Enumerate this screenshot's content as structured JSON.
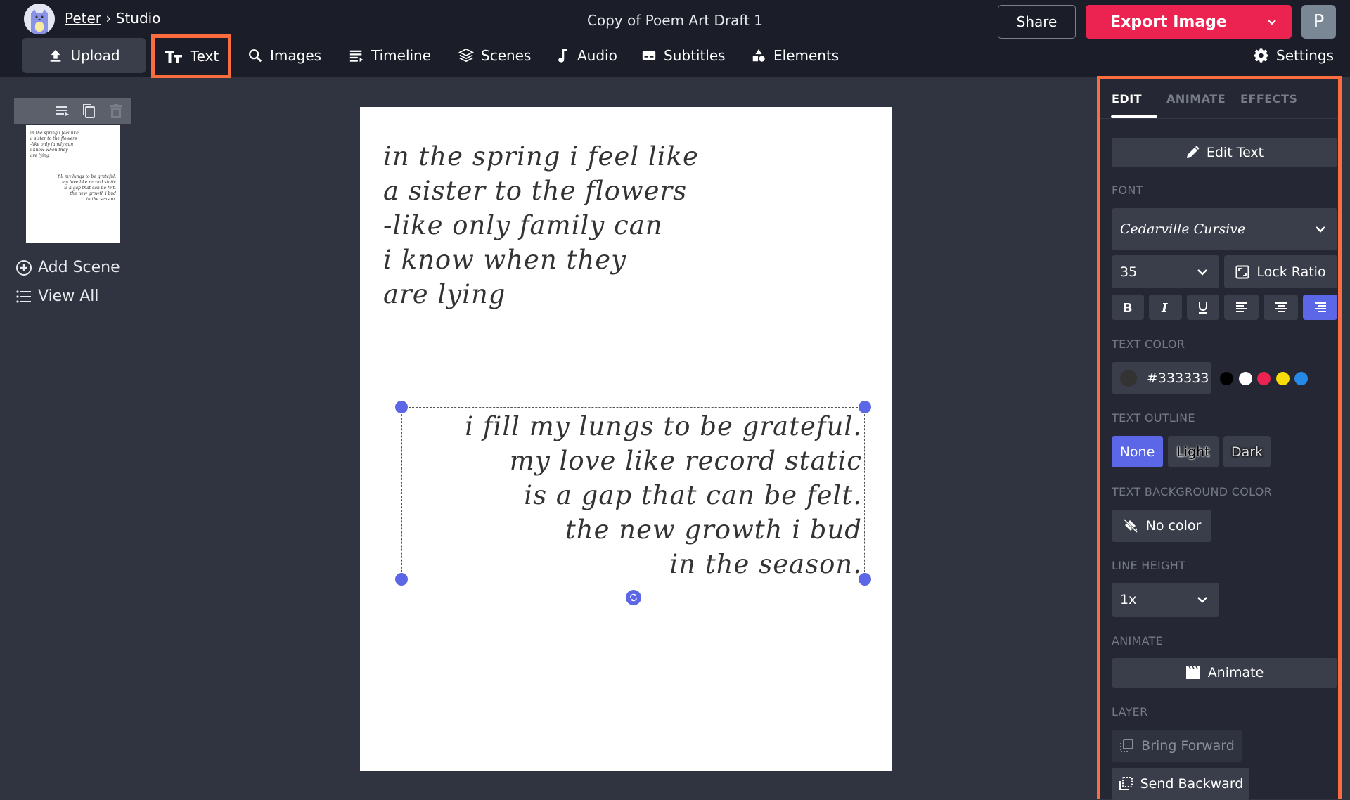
{
  "header": {
    "breadcrumb_user": "Peter",
    "breadcrumb_sep": "›",
    "breadcrumb_page": "Studio",
    "title": "Copy of Poem Art Draft 1",
    "share_label": "Share",
    "export_label": "Export Image",
    "user_initial": "P"
  },
  "nav": {
    "items": [
      {
        "label": "Upload",
        "icon": "upload-icon"
      },
      {
        "label": "Text",
        "icon": "text-icon"
      },
      {
        "label": "Images",
        "icon": "search-icon"
      },
      {
        "label": "Timeline",
        "icon": "timeline-icon"
      },
      {
        "label": "Scenes",
        "icon": "layers-icon"
      },
      {
        "label": "Audio",
        "icon": "music-note-icon"
      },
      {
        "label": "Subtitles",
        "icon": "subtitles-icon"
      },
      {
        "label": "Elements",
        "icon": "shapes-icon"
      }
    ],
    "settings_label": "Settings"
  },
  "sidebar": {
    "add_scene_label": "Add Scene",
    "view_all_label": "View All",
    "thumb_text_1": "in the spring i feel like\na sister to the flowers\n-like only family can\ni know when they\nare lying",
    "thumb_text_2": "i fill my lungs to be grateful.\nmy love like record static\nis a gap that can be felt.\nthe new growth i bud\nin the season."
  },
  "canvas": {
    "poem_top": "in the spring i feel like\na sister to the flowers\n-like only family can\ni know when they\nare lying",
    "poem_bottom": "i fill my lungs to be grateful.\nmy love like record static\nis a gap that can be felt.\nthe new growth i bud\nin the season."
  },
  "panel": {
    "tabs": [
      "EDIT",
      "ANIMATE",
      "EFFECTS"
    ],
    "active_tab": "EDIT",
    "edit_text_label": "Edit Text",
    "font_label": "FONT",
    "font_value": "Cedarville Cursive",
    "font_size": "35",
    "lock_ratio_label": "Lock Ratio",
    "format_buttons": [
      "bold",
      "italic",
      "underline",
      "align-left",
      "align-center",
      "align-right"
    ],
    "active_alignment": "align-right",
    "text_color_label": "TEXT COLOR",
    "text_color_value": "#333333",
    "swatches": [
      "#000000",
      "#ffffff",
      "#ec2350",
      "#f7dc0b",
      "#2589e8"
    ],
    "text_outline_label": "TEXT OUTLINE",
    "outline_options": [
      "None",
      "Light",
      "Dark"
    ],
    "outline_active": "None",
    "text_bg_label": "TEXT BACKGROUND COLOR",
    "no_color_label": "No color",
    "line_height_label": "LINE HEIGHT",
    "line_height_value": "1x",
    "animate_label": "ANIMATE",
    "animate_button": "Animate",
    "layer_label": "LAYER",
    "bring_forward_label": "Bring Forward",
    "send_backward_label": "Send Backward"
  },
  "colors": {
    "accent": "#5b67e6",
    "export": "#ec2350",
    "highlight": "#fb6d3f"
  }
}
